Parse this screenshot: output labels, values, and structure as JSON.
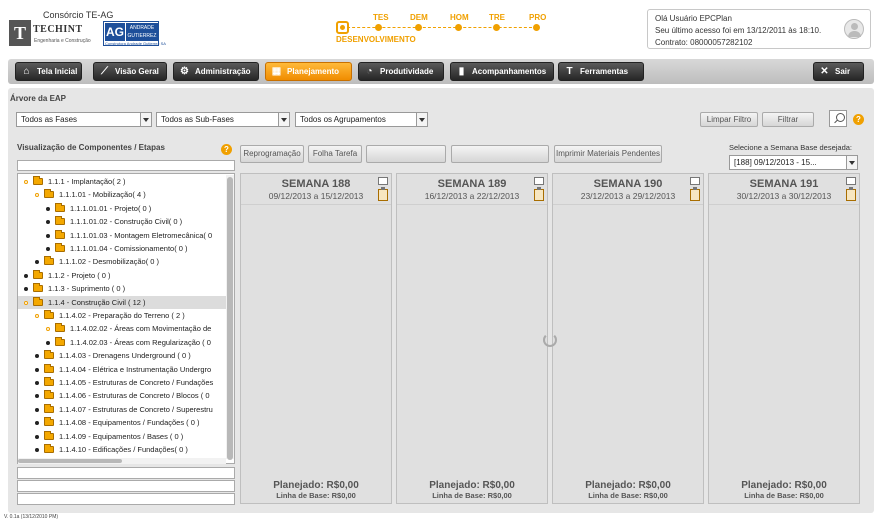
{
  "header": {
    "company": "Consórcio TE-AG",
    "logo_t": "T",
    "logo_techint": "TECHINT",
    "logo_techint_sub": "Engenharia e Construção",
    "logo_ag": "AG",
    "logo_ag_name": "ANDRADE GUTIERREZ",
    "logo_ag_sub": "Construtora Andrade Gutierrez SA",
    "environments": [
      "TES",
      "DEM",
      "HOM",
      "TRE",
      "PRO"
    ],
    "current_environment": "DESENVOLVIMENTO",
    "accent_color": "#f0a000"
  },
  "user": {
    "greeting": "Olá Usuário EPCPlan",
    "last_access": "Seu último acesso foi em  13/12/2011 às 18:10.",
    "contract": "Contrato: 08000057282102"
  },
  "nav": {
    "items": [
      {
        "label": "Tela Inicial",
        "icon": "home-icon"
      },
      {
        "label": "Visão Geral",
        "icon": "telescope-icon"
      },
      {
        "label": "Administração",
        "icon": "gear-icon"
      },
      {
        "label": "Planejamento",
        "icon": "map-icon",
        "active": true
      },
      {
        "label": "Produtividade",
        "icon": "chart-icon"
      },
      {
        "label": "Acompanhamentos",
        "icon": "book-icon"
      },
      {
        "label": "Ferramentas",
        "icon": "hammer-icon"
      }
    ],
    "exit_label": "Sair",
    "active_color": "#f7a21b"
  },
  "page": {
    "title": "Árvore da EAP",
    "filters": {
      "fases": "Todos as Fases",
      "subfases": "Todos as Sub-Fases",
      "agrupamentos": "Todos os Agrupamentos"
    },
    "clear_filter": "Limpar Filtro",
    "filter": "Filtrar"
  },
  "tree": {
    "title": "Visualização de Componentes / Etapas",
    "items": [
      {
        "label": "1.1.1 - Implantação( 2 )",
        "level": 1,
        "open": true
      },
      {
        "label": "1.1.1.01 - Mobilização( 4 )",
        "level": 2,
        "open": true
      },
      {
        "label": "1.1.1.01.01 - Projeto( 0 )",
        "level": 3,
        "open": false
      },
      {
        "label": "1.1.1.01.02 - Construção Civil( 0 )",
        "level": 3,
        "open": false
      },
      {
        "label": "1.1.1.01.03 - Montagem Eletromecânica( 0",
        "level": 3,
        "open": false
      },
      {
        "label": "1.1.1.01.04 - Comissionamento( 0 )",
        "level": 3,
        "open": false
      },
      {
        "label": "1.1.1.02 - Desmobilização( 0 )",
        "level": 2,
        "open": false
      },
      {
        "label": "1.1.2 - Projeto ( 0 )",
        "level": 1,
        "open": false
      },
      {
        "label": "1.1.3 - Suprimento ( 0 )",
        "level": 1,
        "open": false
      },
      {
        "label": "1.1.4 - Construção Civil ( 12 )",
        "level": 1,
        "open": true,
        "selected": true
      },
      {
        "label": "1.1.4.02 - Preparação do Terreno ( 2 )",
        "level": 2,
        "open": true
      },
      {
        "label": "1.1.4.02.02 - Áreas com Movimentação de",
        "level": 3,
        "open": true
      },
      {
        "label": "1.1.4.02.03 - Áreas com Regularização ( 0",
        "level": 3,
        "open": false
      },
      {
        "label": "1.1.4.03 - Drenagens Underground ( 0 )",
        "level": 2,
        "open": false
      },
      {
        "label": "1.1.4.04 - Elétrica e Instrumentação Undergro",
        "level": 2,
        "open": false
      },
      {
        "label": "1.1.4.05 - Estruturas de Concreto / Fundações",
        "level": 2,
        "open": false
      },
      {
        "label": "1.1.4.06 - Estruturas de Concreto / Blocos ( 0",
        "level": 2,
        "open": false
      },
      {
        "label": "1.1.4.07 - Estruturas de Concreto / Superestru",
        "level": 2,
        "open": false
      },
      {
        "label": "1.1.4.08 - Equipamentos / Fundações ( 0 )",
        "level": 2,
        "open": false
      },
      {
        "label": "1.1.4.09 - Equipamentos / Bases ( 0 )",
        "level": 2,
        "open": false
      },
      {
        "label": "1.1.4.10 - Edificações / Fundações( 0 )",
        "level": 2,
        "open": false
      }
    ]
  },
  "toolbar": {
    "reprogramacao": "Reprogramação",
    "folha_tarefa": "Folha Tarefa",
    "imprimir": "Imprimir Materiais Pendentes"
  },
  "semana_base": {
    "label": "Selecione a Semana Base desejada:",
    "value": "[188] 09/12/2013 - 15..."
  },
  "weeks": [
    {
      "name": "SEMANA 188",
      "dates": "09/12/2013 a 15/12/2013",
      "planned": "Planejado: R$0,00",
      "baseline": "Linha de Base: R$0,00"
    },
    {
      "name": "SEMANA 189",
      "dates": "16/12/2013 a 22/12/2013",
      "planned": "Planejado: R$0,00",
      "baseline": "Linha de Base: R$0,00"
    },
    {
      "name": "SEMANA 190",
      "dates": "23/12/2013 a 29/12/2013",
      "planned": "Planejado: R$0,00",
      "baseline": "Linha de Base: R$0,00"
    },
    {
      "name": "SEMANA 191",
      "dates": "30/12/2013 a 30/12/2013",
      "planned": "Planejado: R$0,00",
      "baseline": "Linha de Base: R$0,00"
    }
  ],
  "footer": {
    "version": "V. 0.1a (13/12/2010 PM)"
  }
}
